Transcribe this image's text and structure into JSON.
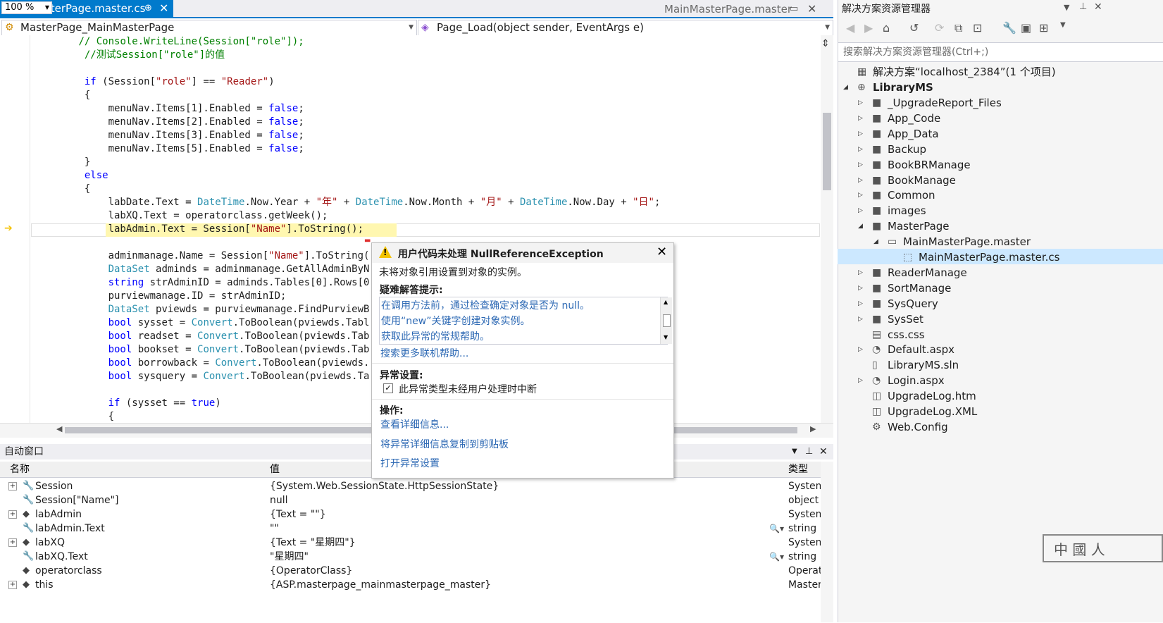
{
  "tabs": {
    "active": {
      "label": "MainMasterPage.master.cs",
      "pin": "⊕",
      "close": "✕"
    },
    "preview": {
      "label": "MainMasterPage.master",
      "pin": "▭",
      "close": "✕"
    }
  },
  "navbar": {
    "class_dropdown": "MasterPage_MainMasterPage",
    "method_dropdown": "Page_Load(object sender, EventArgs e)"
  },
  "code_lines": [
    "        // Console.WriteLine(Session[\"role\"]);",
    "         //测试Session[\"role\"]的值",
    "",
    "         if (Session[\"role\"] == \"Reader\")",
    "         {",
    "             menuNav.Items[1].Enabled = false;",
    "             menuNav.Items[2].Enabled = false;",
    "             menuNav.Items[3].Enabled = false;",
    "             menuNav.Items[5].Enabled = false;",
    "         }",
    "         else",
    "         {",
    "             labDate.Text = DateTime.Now.Year + \"年\" + DateTime.Now.Month + \"月\" + DateTime.Now.Day + \"日\";",
    "             labXQ.Text = operatorclass.getWeek();",
    "             labAdmin.Text = Session[\"Name\"].ToString();",
    "",
    "             adminmanage.Name = Session[\"Name\"].ToString(",
    "             DataSet adminds = adminmanage.GetAllAdminByN",
    "             string strAdminID = adminds.Tables[0].Rows[0",
    "             purviewmanage.ID = strAdminID;",
    "             DataSet pviewds = purviewmanage.FindPurviewB",
    "             bool sysset = Convert.ToBoolean(pviewds.Tabl",
    "             bool readset = Convert.ToBoolean(pviewds.Tab",
    "             bool bookset = Convert.ToBoolean(pviewds.Tab",
    "             bool borrowback = Convert.ToBoolean(pviewds.",
    "             bool sysquery = Convert.ToBoolean(pviewds.Ta",
    "",
    "             if (sysset == true)",
    "             {"
  ],
  "zoom": "100 %",
  "autos": {
    "title": "自动窗口",
    "col_name": "名称",
    "col_value": "值",
    "col_type": "类型",
    "rows": [
      {
        "name": "Session",
        "value": "{System.Web.SessionState.HttpSessionState}",
        "type": "System",
        "expandable": "+"
      },
      {
        "name": "Session[\"Name\"]",
        "value": "null",
        "type": "object",
        "expandable": ""
      },
      {
        "name": "labAdmin",
        "value": "{Text = \"\"}",
        "type": "System",
        "expandable": "+"
      },
      {
        "name": "labAdmin.Text",
        "value": "\"\"",
        "type": "string",
        "expandable": ""
      },
      {
        "name": "labXQ",
        "value": "{Text = \"星期四\"}",
        "type": "System",
        "expandable": "+"
      },
      {
        "name": "labXQ.Text",
        "value": "\"星期四\"",
        "type": "string",
        "expandable": ""
      },
      {
        "name": "operatorclass",
        "value": "{OperatorClass}",
        "type": "Operat",
        "expandable": ""
      },
      {
        "name": "this",
        "value": "{ASP.masterpage_mainmasterpage_master}",
        "type": "Master",
        "expandable": "+"
      }
    ]
  },
  "exception": {
    "title": "用户代码未处理 NullReferenceException",
    "message": "未将对象引用设置到对象的实例。",
    "tips_header": "疑难解答提示:",
    "tips": [
      "在调用方法前，通过检查确定对象是否为 null。",
      "使用“new”关键字创建对象实例。",
      "获取此异常的常规帮助。"
    ],
    "search_more": "搜索更多联机帮助...",
    "settings_header": "异常设置:",
    "settings_checkbox": "此异常类型未经用户处理时中断",
    "actions_header": "操作:",
    "actions": [
      "查看详细信息...",
      "将异常详细信息复制到剪贴板",
      "打开异常设置"
    ]
  },
  "solution_explorer": {
    "title": "解决方案资源管理器",
    "search_placeholder": "搜索解决方案资源管理器(Ctrl+;)",
    "solution": "解决方案“localhost_2384”(1 个项目)",
    "project": "LibraryMS",
    "items": [
      "_UpgradeReport_Files",
      "App_Code",
      "App_Data",
      "Backup",
      "BookBRManage",
      "BookManage",
      "Common",
      "images",
      "MasterPage",
      "MainMasterPage.master",
      "MainMasterPage.master.cs",
      "ReaderManage",
      "SortManage",
      "SysQuery",
      "SysSet",
      "css.css",
      "Default.aspx",
      "LibraryMS.sln",
      "Login.aspx",
      "UpgradeLog.htm",
      "UpgradeLog.XML",
      "Web.Config"
    ]
  },
  "watermark": "中 國 人",
  "colors": {
    "accent": "#007ACC",
    "keyword": "#0000ff",
    "type": "#2b91af",
    "string": "#a31515",
    "comment": "#008000",
    "link": "#2d69b4"
  }
}
